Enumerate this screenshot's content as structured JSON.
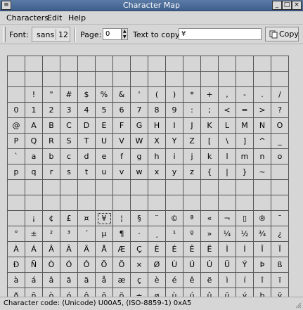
{
  "window": {
    "title": "Character Map",
    "menu_glyph": "≡",
    "min_glyph": "_",
    "max_glyph": "□",
    "close_glyph": "×"
  },
  "menubar": {
    "characters": "Characters",
    "edit": "Edit",
    "help": "Help"
  },
  "toolbar": {
    "font_label": "Font:",
    "font_name": "sans",
    "font_size": "12",
    "page_label": "Page:",
    "page_value": "0",
    "copy_label": "Text to copy:",
    "copy_value": "¥",
    "copy_button": "Copy"
  },
  "grid": {
    "rows": [
      [
        "",
        "",
        "",
        "",
        "",
        "",
        "",
        "",
        "",
        "",
        "",
        "",
        "",
        "",
        "",
        ""
      ],
      [
        "",
        "",
        "",
        "",
        "",
        "",
        "",
        "",
        "",
        "",
        "",
        "",
        "",
        "",
        "",
        ""
      ],
      [
        "",
        "!",
        "\"",
        "#",
        "$",
        "%",
        "&",
        "'",
        "(",
        ")",
        "*",
        "+",
        ",",
        "-",
        ".",
        "/"
      ],
      [
        "0",
        "1",
        "2",
        "3",
        "4",
        "5",
        "6",
        "7",
        "8",
        "9",
        ":",
        ";",
        "<",
        "=",
        ">",
        "?"
      ],
      [
        "@",
        "A",
        "B",
        "C",
        "D",
        "E",
        "F",
        "G",
        "H",
        "I",
        "J",
        "K",
        "L",
        "M",
        "N",
        "O"
      ],
      [
        "P",
        "Q",
        "R",
        "S",
        "T",
        "U",
        "V",
        "W",
        "X",
        "Y",
        "Z",
        "[",
        "\\",
        "]",
        "^",
        "_"
      ],
      [
        "`",
        "a",
        "b",
        "c",
        "d",
        "e",
        "f",
        "g",
        "h",
        "i",
        "j",
        "k",
        "l",
        "m",
        "n",
        "o"
      ],
      [
        "p",
        "q",
        "r",
        "s",
        "t",
        "u",
        "v",
        "w",
        "x",
        "y",
        "z",
        "{",
        "|",
        "}",
        "~",
        ""
      ],
      [
        "",
        "",
        "",
        "",
        "",
        "",
        "",
        "",
        "",
        "",
        "",
        "",
        "",
        "",
        "",
        ""
      ],
      [
        "",
        "",
        "",
        "",
        "",
        "",
        "",
        "",
        "",
        "",
        "",
        "",
        "",
        "",
        "",
        ""
      ],
      [
        "",
        "¡",
        "¢",
        "£",
        "¤",
        "¥",
        "¦",
        "§",
        "¨",
        "©",
        "ª",
        "«",
        "¬",
        "▯",
        "®",
        "¯"
      ],
      [
        "°",
        "±",
        "²",
        "³",
        "´",
        "µ",
        "¶",
        "·",
        "¸",
        "¹",
        "º",
        "»",
        "¼",
        "½",
        "¾",
        "¿"
      ],
      [
        "À",
        "Á",
        "Â",
        "Ã",
        "Ä",
        "Å",
        "Æ",
        "Ç",
        "È",
        "É",
        "Ê",
        "Ë",
        "Ì",
        "Í",
        "Î",
        "Ï"
      ],
      [
        "Ð",
        "Ñ",
        "Ò",
        "Ó",
        "Ô",
        "Õ",
        "Ö",
        "×",
        "Ø",
        "Ù",
        "Ú",
        "Û",
        "Ü",
        "Ý",
        "Þ",
        "ß"
      ],
      [
        "à",
        "á",
        "â",
        "ã",
        "ä",
        "å",
        "æ",
        "ç",
        "è",
        "é",
        "ê",
        "ë",
        "ì",
        "í",
        "î",
        "ï"
      ],
      [
        "ð",
        "ñ",
        "ò",
        "ó",
        "ô",
        "õ",
        "ö",
        "÷",
        "ø",
        "ù",
        "ú",
        "û",
        "ü",
        "ý",
        "þ",
        "ÿ"
      ]
    ],
    "selected_char": "¥"
  },
  "status": {
    "text": "Character code: (Unicode) U00A5, (ISO-8859-1) 0xA5"
  }
}
